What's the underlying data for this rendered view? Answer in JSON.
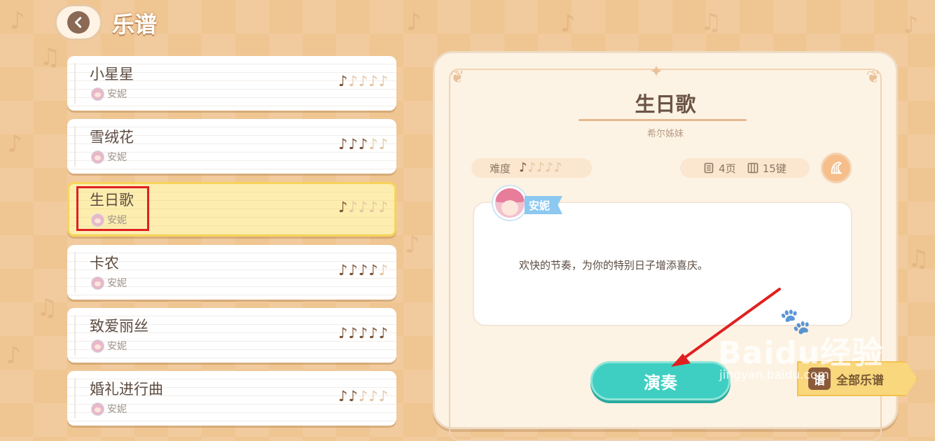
{
  "header": {
    "back_label": "back",
    "title": "乐谱"
  },
  "songs": [
    {
      "title": "小星星",
      "author": "安妮",
      "difficulty": 1,
      "max_difficulty": 5,
      "selected": false
    },
    {
      "title": "雪绒花",
      "author": "安妮",
      "difficulty": 3,
      "max_difficulty": 5,
      "selected": false
    },
    {
      "title": "生日歌",
      "author": "安妮",
      "difficulty": 1,
      "max_difficulty": 5,
      "selected": true
    },
    {
      "title": "卡农",
      "author": "安妮",
      "difficulty": 4,
      "max_difficulty": 5,
      "selected": false
    },
    {
      "title": "致爱丽丝",
      "author": "安妮",
      "difficulty": 5,
      "max_difficulty": 5,
      "selected": false
    },
    {
      "title": "婚礼进行曲",
      "author": "安妮",
      "difficulty": 2,
      "max_difficulty": 5,
      "selected": false
    }
  ],
  "detail": {
    "title": "生日歌",
    "artist": "希尔姊妹",
    "difficulty_label": "难度",
    "difficulty": 1,
    "max_difficulty": 5,
    "pages": "4页",
    "keys": "15键",
    "narrator": "安妮",
    "description": "欢快的节奏，为你的特别日子增添喜庆。"
  },
  "actions": {
    "play_label": "演奏",
    "score_tab_label": "全部乐谱",
    "score_icon_char": "谱"
  },
  "watermark": {
    "main": "Baidu经验",
    "sub": "jingyan.baidu.com"
  },
  "colors": {
    "background": "#efc592",
    "note_on": "#7a4f32",
    "note_off": "#e2c49f",
    "selected_bg": "#fdeeb0",
    "selected_border": "#f7d45a",
    "play_button": "#3fcfc2",
    "annotation_red": "#e02020"
  },
  "icons": {
    "back": "chevron-left-icon",
    "difficulty": "music-note-icon",
    "pages": "document-icon",
    "keys": "piano-keys-icon",
    "harp": "harp-icon"
  }
}
